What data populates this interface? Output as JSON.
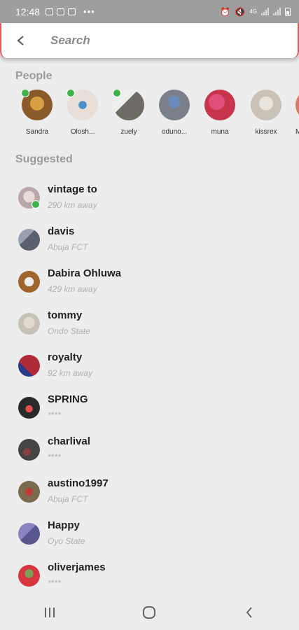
{
  "status_bar": {
    "time": "12:48",
    "dots": "•••",
    "network": "4G"
  },
  "search": {
    "placeholder": "Search"
  },
  "sections": {
    "people": "People",
    "suggested": "Suggested"
  },
  "people": [
    {
      "name": "Sandra",
      "online": true,
      "color": "#8a5a2a"
    },
    {
      "name": "Olosh...",
      "online": true,
      "color": "#e8e0d8"
    },
    {
      "name": "zuely",
      "online": true,
      "color": "#6e6a66"
    },
    {
      "name": "oduno...",
      "online": false,
      "color": "#7a7f8a"
    },
    {
      "name": "muna",
      "online": false,
      "color": "#c8344c"
    },
    {
      "name": "kissrex",
      "online": false,
      "color": "#c9c2b6"
    },
    {
      "name": "M",
      "online": false,
      "color": "#d67a6a"
    }
  ],
  "suggested": [
    {
      "name": "vintage to",
      "location": "290 km away",
      "online": true,
      "color": "#b9a7a9"
    },
    {
      "name": "davis",
      "location": "Abuja FCT",
      "online": false,
      "color": "#5a5f6e"
    },
    {
      "name": "Dabira Ohluwa",
      "location": "429 km away",
      "online": false,
      "color": "#a0652e"
    },
    {
      "name": "tommy",
      "location": "Ondo State",
      "online": false,
      "color": "#c7c2b7"
    },
    {
      "name": "royalty",
      "location": "92 km away",
      "online": false,
      "color": "#b02a3a"
    },
    {
      "name": "SPRING",
      "location": "****",
      "online": false,
      "color": "#2a2a2a"
    },
    {
      "name": "charlival",
      "location": "****",
      "online": false,
      "color": "#444444"
    },
    {
      "name": "austino1997",
      "location": "Abuja FCT",
      "online": false,
      "color": "#7a6a4e"
    },
    {
      "name": "Happy",
      "location": "Oyo State",
      "online": false,
      "color": "#5a5690"
    },
    {
      "name": "oliverjames",
      "location": "****",
      "online": false,
      "color": "#d8363e"
    }
  ]
}
